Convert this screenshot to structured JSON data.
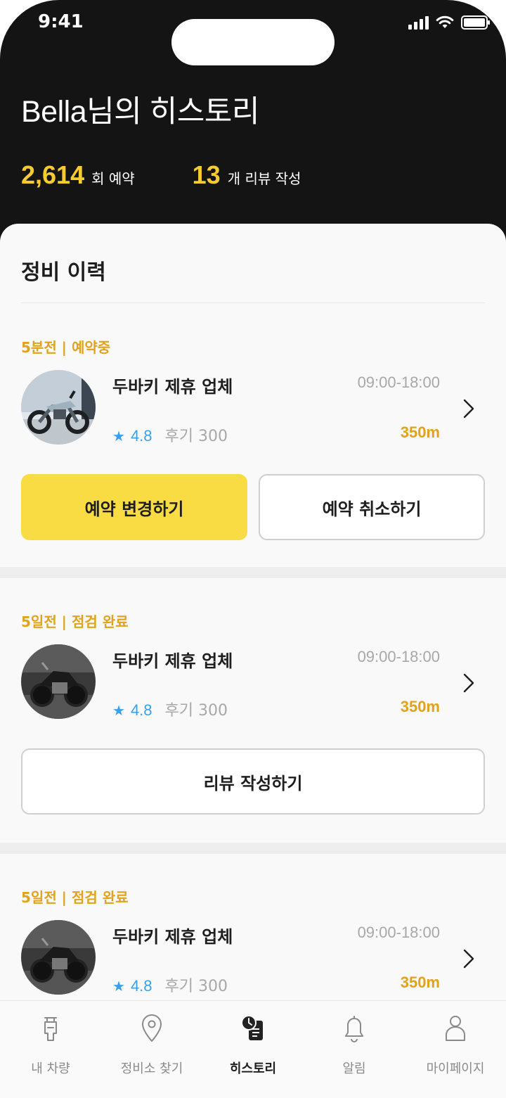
{
  "status_bar": {
    "time": "9:41"
  },
  "header": {
    "title": "Bella님의 히스토리",
    "stats": [
      {
        "value": "2,614",
        "label": "회 예약"
      },
      {
        "value": "13",
        "label": "개 리뷰 작성"
      }
    ]
  },
  "section": {
    "title": "정비 이력"
  },
  "cards": [
    {
      "status": "5분전 | 예약중",
      "shop_name": "두바키 제휴 업체",
      "hours": "09:00-18:00",
      "rating": "4.8",
      "reviews": "후기 300",
      "distance": "350m",
      "image": "silver-motorcycle",
      "buttons": [
        "예약 변경하기",
        "예약 취소하기"
      ]
    },
    {
      "status": "5일전 | 점검 완료",
      "shop_name": "두바키 제휴 업체",
      "hours": "09:00-18:00",
      "rating": "4.8",
      "reviews": "후기 300",
      "distance": "350m",
      "image": "black-cruiser-motorcycle",
      "buttons": [
        "리뷰 작성하기"
      ]
    },
    {
      "status": "5일전 | 점검 완료",
      "shop_name": "두바키 제휴 업체",
      "hours": "09:00-18:00",
      "rating": "4.8",
      "reviews": "후기 300",
      "distance": "350m",
      "image": "black-cruiser-motorcycle",
      "buttons": []
    }
  ],
  "tabbar": {
    "items": [
      {
        "label": "내 차량",
        "icon": "scooter-icon"
      },
      {
        "label": "정비소 찾기",
        "icon": "location-pin-icon"
      },
      {
        "label": "히스토리",
        "icon": "history-clock-icon",
        "active": true
      },
      {
        "label": "알림",
        "icon": "bell-icon"
      },
      {
        "label": "마이페이지",
        "icon": "person-icon"
      }
    ]
  },
  "colors": {
    "header_bg": "#141414",
    "accent_yellow": "#f5cb2d",
    "button_yellow": "#f9dc44",
    "status_orange": "#e2a21a",
    "rating_blue": "#3aa0ec"
  }
}
